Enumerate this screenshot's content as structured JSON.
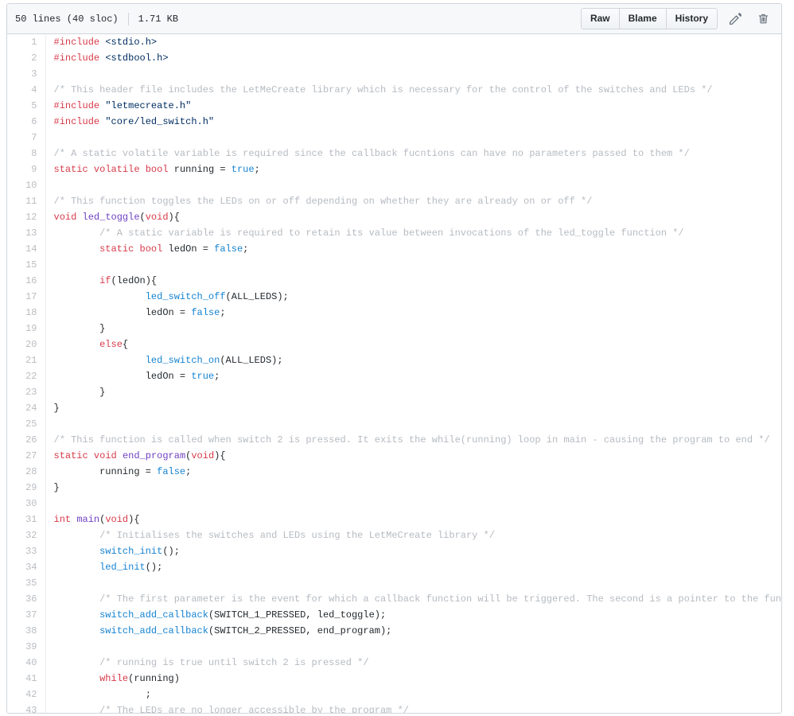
{
  "header": {
    "lines_text": "50 lines (40 sloc)",
    "size_text": "1.71 KB",
    "buttons": [
      {
        "label": "Raw",
        "name": "raw-button"
      },
      {
        "label": "Blame",
        "name": "blame-button"
      },
      {
        "label": "History",
        "name": "history-button"
      }
    ],
    "edit_icon": "pencil-icon",
    "delete_icon": "trash-icon"
  },
  "code": {
    "language": "c",
    "lines": [
      {
        "n": "1",
        "tokens": [
          {
            "t": "#include ",
            "c": "pp"
          },
          {
            "t": "<stdio.h>",
            "c": "s"
          }
        ]
      },
      {
        "n": "2",
        "tokens": [
          {
            "t": "#include ",
            "c": "pp"
          },
          {
            "t": "<stdbool.h>",
            "c": "s"
          }
        ]
      },
      {
        "n": "3",
        "tokens": []
      },
      {
        "n": "4",
        "tokens": [
          {
            "t": "/* This header file includes the LetMeCreate library which is necessary for the control of the switches and LEDs */",
            "c": "c"
          }
        ]
      },
      {
        "n": "5",
        "tokens": [
          {
            "t": "#include ",
            "c": "pp"
          },
          {
            "t": "\"letmecreate.h\"",
            "c": "s"
          }
        ]
      },
      {
        "n": "6",
        "tokens": [
          {
            "t": "#include ",
            "c": "pp"
          },
          {
            "t": "\"core/led_switch.h\"",
            "c": "s"
          }
        ]
      },
      {
        "n": "7",
        "tokens": []
      },
      {
        "n": "8",
        "tokens": [
          {
            "t": "/* A static volatile variable is required since the callback fucntions can have no parameters passed to them */",
            "c": "c"
          }
        ]
      },
      {
        "n": "9",
        "tokens": [
          {
            "t": "static",
            "c": "k"
          },
          {
            "t": " ",
            "c": "p"
          },
          {
            "t": "volatile",
            "c": "k"
          },
          {
            "t": " ",
            "c": "p"
          },
          {
            "t": "bool",
            "c": "k"
          },
          {
            "t": " running = ",
            "c": "p"
          },
          {
            "t": "true",
            "c": "cn"
          },
          {
            "t": ";",
            "c": "p"
          }
        ]
      },
      {
        "n": "10",
        "tokens": []
      },
      {
        "n": "11",
        "tokens": [
          {
            "t": "/* This function toggles the LEDs on or off depending on whether they are already on or off */",
            "c": "c"
          }
        ]
      },
      {
        "n": "12",
        "tokens": [
          {
            "t": "void",
            "c": "k"
          },
          {
            "t": " ",
            "c": "p"
          },
          {
            "t": "led_toggle",
            "c": "fn"
          },
          {
            "t": "(",
            "c": "p"
          },
          {
            "t": "void",
            "c": "k"
          },
          {
            "t": "){",
            "c": "p"
          }
        ]
      },
      {
        "n": "13",
        "tokens": [
          {
            "t": "        ",
            "c": "p"
          },
          {
            "t": "/* A static variable is required to retain its value between invocations of the led_toggle function */",
            "c": "c"
          }
        ]
      },
      {
        "n": "14",
        "tokens": [
          {
            "t": "        ",
            "c": "p"
          },
          {
            "t": "static",
            "c": "k"
          },
          {
            "t": " ",
            "c": "p"
          },
          {
            "t": "bool",
            "c": "k"
          },
          {
            "t": " ledOn = ",
            "c": "p"
          },
          {
            "t": "false",
            "c": "cn"
          },
          {
            "t": ";",
            "c": "p"
          }
        ]
      },
      {
        "n": "15",
        "tokens": []
      },
      {
        "n": "16",
        "tokens": [
          {
            "t": "        ",
            "c": "p"
          },
          {
            "t": "if",
            "c": "k"
          },
          {
            "t": "(ledOn){",
            "c": "p"
          }
        ]
      },
      {
        "n": "17",
        "tokens": [
          {
            "t": "                ",
            "c": "p"
          },
          {
            "t": "led_switch_off",
            "c": "cl"
          },
          {
            "t": "(ALL_LEDS);",
            "c": "p"
          }
        ]
      },
      {
        "n": "18",
        "tokens": [
          {
            "t": "                ledOn = ",
            "c": "p"
          },
          {
            "t": "false",
            "c": "cn"
          },
          {
            "t": ";",
            "c": "p"
          }
        ]
      },
      {
        "n": "19",
        "tokens": [
          {
            "t": "        }",
            "c": "p"
          }
        ]
      },
      {
        "n": "20",
        "tokens": [
          {
            "t": "        ",
            "c": "p"
          },
          {
            "t": "else",
            "c": "k"
          },
          {
            "t": "{",
            "c": "p"
          }
        ]
      },
      {
        "n": "21",
        "tokens": [
          {
            "t": "                ",
            "c": "p"
          },
          {
            "t": "led_switch_on",
            "c": "cl"
          },
          {
            "t": "(ALL_LEDS);",
            "c": "p"
          }
        ]
      },
      {
        "n": "22",
        "tokens": [
          {
            "t": "                ledOn = ",
            "c": "p"
          },
          {
            "t": "true",
            "c": "cn"
          },
          {
            "t": ";",
            "c": "p"
          }
        ]
      },
      {
        "n": "23",
        "tokens": [
          {
            "t": "        }",
            "c": "p"
          }
        ]
      },
      {
        "n": "24",
        "tokens": [
          {
            "t": "}",
            "c": "p"
          }
        ]
      },
      {
        "n": "25",
        "tokens": []
      },
      {
        "n": "26",
        "tokens": [
          {
            "t": "/* This function is called when switch 2 is pressed. It exits the while(running) loop in main - causing the program to end */",
            "c": "c"
          }
        ]
      },
      {
        "n": "27",
        "tokens": [
          {
            "t": "static",
            "c": "k"
          },
          {
            "t": " ",
            "c": "p"
          },
          {
            "t": "void",
            "c": "k"
          },
          {
            "t": " ",
            "c": "p"
          },
          {
            "t": "end_program",
            "c": "fn"
          },
          {
            "t": "(",
            "c": "p"
          },
          {
            "t": "void",
            "c": "k"
          },
          {
            "t": "){",
            "c": "p"
          }
        ]
      },
      {
        "n": "28",
        "tokens": [
          {
            "t": "        running = ",
            "c": "p"
          },
          {
            "t": "false",
            "c": "cn"
          },
          {
            "t": ";",
            "c": "p"
          }
        ]
      },
      {
        "n": "29",
        "tokens": [
          {
            "t": "}",
            "c": "p"
          }
        ]
      },
      {
        "n": "30",
        "tokens": []
      },
      {
        "n": "31",
        "tokens": [
          {
            "t": "int",
            "c": "k"
          },
          {
            "t": " ",
            "c": "p"
          },
          {
            "t": "main",
            "c": "fn"
          },
          {
            "t": "(",
            "c": "p"
          },
          {
            "t": "void",
            "c": "k"
          },
          {
            "t": "){",
            "c": "p"
          }
        ]
      },
      {
        "n": "32",
        "tokens": [
          {
            "t": "        ",
            "c": "p"
          },
          {
            "t": "/* Initialises the switches and LEDs using the LetMeCreate library */",
            "c": "c"
          }
        ]
      },
      {
        "n": "33",
        "tokens": [
          {
            "t": "        ",
            "c": "p"
          },
          {
            "t": "switch_init",
            "c": "cl"
          },
          {
            "t": "();",
            "c": "p"
          }
        ]
      },
      {
        "n": "34",
        "tokens": [
          {
            "t": "        ",
            "c": "p"
          },
          {
            "t": "led_init",
            "c": "cl"
          },
          {
            "t": "();",
            "c": "p"
          }
        ]
      },
      {
        "n": "35",
        "tokens": []
      },
      {
        "n": "36",
        "tokens": [
          {
            "t": "        ",
            "c": "p"
          },
          {
            "t": "/* The first parameter is the event for which a callback function will be triggered. The second is a pointer to the function */",
            "c": "c"
          }
        ]
      },
      {
        "n": "37",
        "tokens": [
          {
            "t": "        ",
            "c": "p"
          },
          {
            "t": "switch_add_callback",
            "c": "cl"
          },
          {
            "t": "(SWITCH_1_PRESSED, led_toggle);",
            "c": "p"
          }
        ]
      },
      {
        "n": "38",
        "tokens": [
          {
            "t": "        ",
            "c": "p"
          },
          {
            "t": "switch_add_callback",
            "c": "cl"
          },
          {
            "t": "(SWITCH_2_PRESSED, end_program);",
            "c": "p"
          }
        ]
      },
      {
        "n": "39",
        "tokens": []
      },
      {
        "n": "40",
        "tokens": [
          {
            "t": "        ",
            "c": "p"
          },
          {
            "t": "/* running is true until switch 2 is pressed */",
            "c": "c"
          }
        ]
      },
      {
        "n": "41",
        "tokens": [
          {
            "t": "        ",
            "c": "p"
          },
          {
            "t": "while",
            "c": "k"
          },
          {
            "t": "(running)",
            "c": "p"
          }
        ]
      },
      {
        "n": "42",
        "tokens": [
          {
            "t": "                ;",
            "c": "p"
          }
        ]
      },
      {
        "n": "43",
        "tokens": [
          {
            "t": "        ",
            "c": "p"
          },
          {
            "t": "/* The LEDs are no longer accessible by the program */",
            "c": "c"
          }
        ]
      }
    ]
  }
}
